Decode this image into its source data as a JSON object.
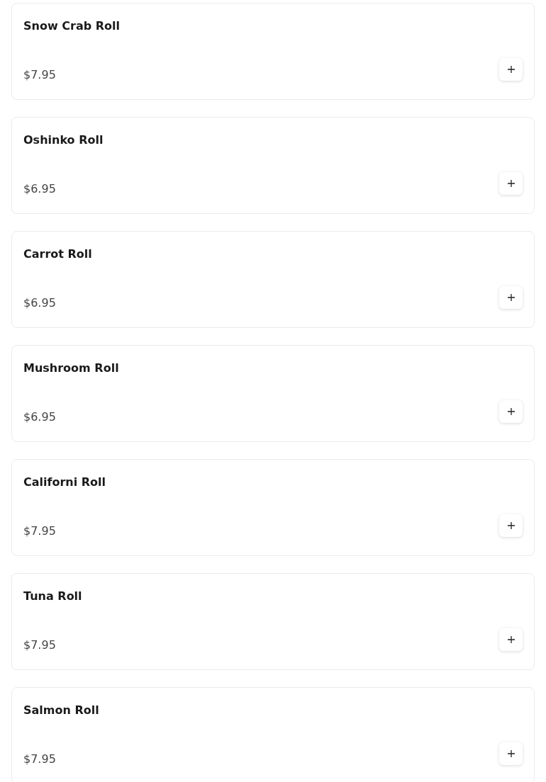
{
  "items": [
    {
      "name": "Snow Crab Roll",
      "price": "$7.95"
    },
    {
      "name": "Oshinko Roll",
      "price": "$6.95"
    },
    {
      "name": "Carrot Roll",
      "price": "$6.95"
    },
    {
      "name": "Mushroom Roll",
      "price": "$6.95"
    },
    {
      "name": "Californi Roll",
      "price": "$7.95"
    },
    {
      "name": "Tuna Roll",
      "price": "$7.95"
    },
    {
      "name": "Salmon Roll",
      "price": "$7.95"
    }
  ]
}
